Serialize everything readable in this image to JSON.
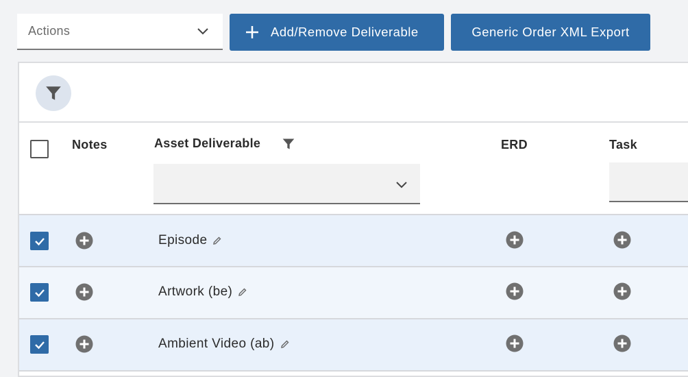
{
  "toolbar": {
    "actions_placeholder": "Actions",
    "add_remove_label": "Add/Remove Deliverable",
    "export_label": "Generic Order XML Export"
  },
  "table": {
    "columns": {
      "notes": "Notes",
      "asset_deliverable": "Asset Deliverable",
      "erd": "ERD",
      "task": "Task"
    },
    "rows": [
      {
        "name": "Episode",
        "checked": true
      },
      {
        "name": "Artwork (be)",
        "checked": true
      },
      {
        "name": "Ambient Video (ab)",
        "checked": true
      }
    ]
  },
  "colors": {
    "accent": "#2f6ba7",
    "row_selected": "#e9f1fb",
    "icon_gray": "#707070"
  },
  "icons": {
    "actions_dropdown": "chevron-down-icon",
    "add_remove": "plus-icon",
    "filter_toggle": "filter-icon",
    "column_filter": "filter-icon",
    "row_add": "add-circle-icon",
    "edit": "pencil-icon"
  }
}
